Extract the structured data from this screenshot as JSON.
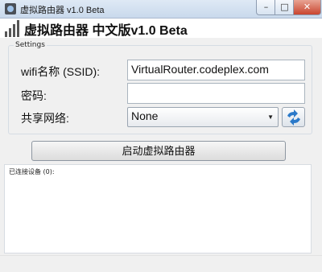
{
  "window": {
    "title": "虚拟路由器 v1.0 Beta",
    "min_label": "–",
    "max_label": "□",
    "close_label": "✕"
  },
  "banner": {
    "title": "虚拟路由器 中文版v1.0 Beta",
    "icon": "signal-bars-icon"
  },
  "settings": {
    "legend": "Settings",
    "ssid_label": "wifi名称 (SSID):",
    "ssid_value": "VirtualRouter.codeplex.com",
    "password_label": "密码:",
    "password_value": "",
    "share_label": "共享网络:",
    "share_selected": "None",
    "refresh_icon": "refresh-arrows-icon"
  },
  "actions": {
    "start_label": "启动虚拟路由器"
  },
  "devices": {
    "header": "已连接设备 (0):"
  },
  "colors": {
    "accent": "#2b79c9",
    "title_bar": "#dfe9f5",
    "close": "#c9452f"
  }
}
